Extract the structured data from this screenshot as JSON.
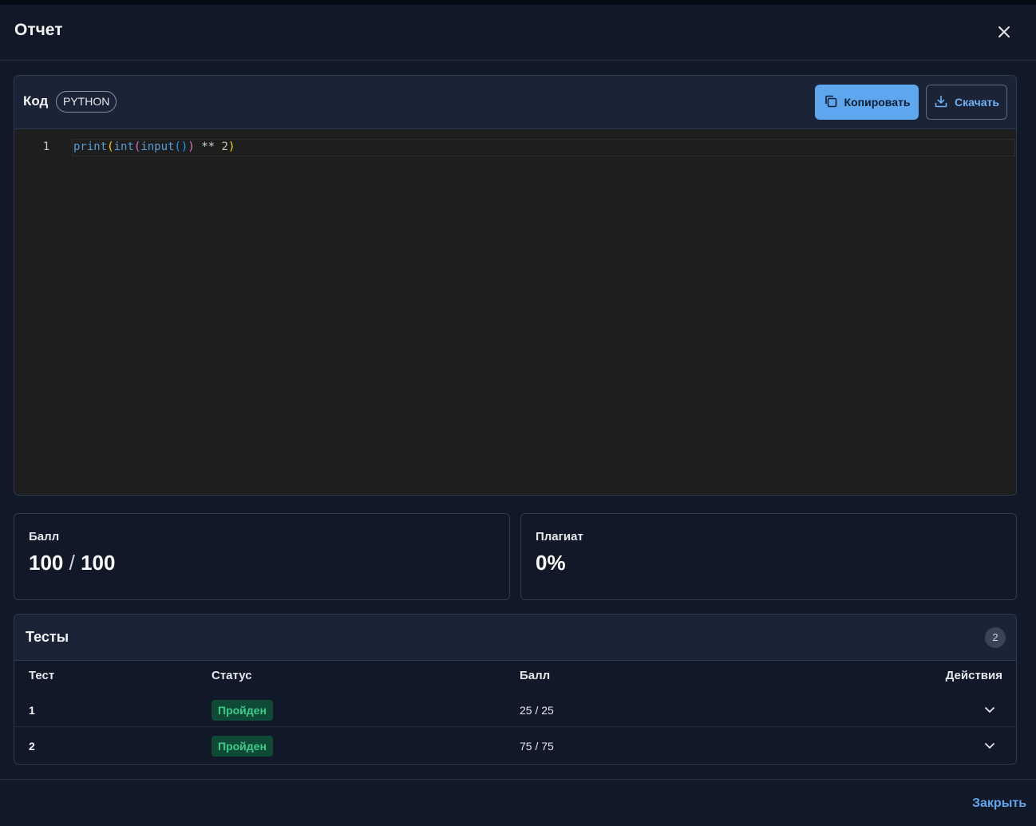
{
  "modal": {
    "title": "Отчет",
    "footer_close_label": "Закрыть"
  },
  "code": {
    "label": "Код",
    "language": "PYTHON",
    "copy_label": "Копировать",
    "download_label": "Скачать",
    "line_number": "1",
    "tokens": {
      "t1": "print",
      "t2": "(",
      "t3": "int",
      "t4": "(",
      "t5": "input",
      "t6": "()",
      "t7": ")",
      "t8": " ** ",
      "t9": "2",
      "t10": ")"
    }
  },
  "stats": {
    "score_label": "Балл",
    "score_value": "100",
    "score_sep": " / ",
    "score_max": "100",
    "plagiarism_label": "Плагиат",
    "plagiarism_value": "0%"
  },
  "tests": {
    "title": "Тесты",
    "count": "2",
    "headers": {
      "test": "Тест",
      "status": "Статус",
      "score": "Балл",
      "actions": "Действия"
    },
    "rows": [
      {
        "id": "1",
        "status": "Пройден",
        "score": "25 / 25"
      },
      {
        "id": "2",
        "status": "Пройден",
        "score": "75 / 75"
      }
    ]
  },
  "colors": {
    "accent": "#5ea6ee",
    "success_text": "#3ecb8a",
    "success_bg": "#0f4a37",
    "panel_bg": "#111827"
  },
  "icons": {
    "close": "close-icon",
    "copy": "copy-icon",
    "download": "download-icon",
    "expand": "chevron-down-icon"
  }
}
